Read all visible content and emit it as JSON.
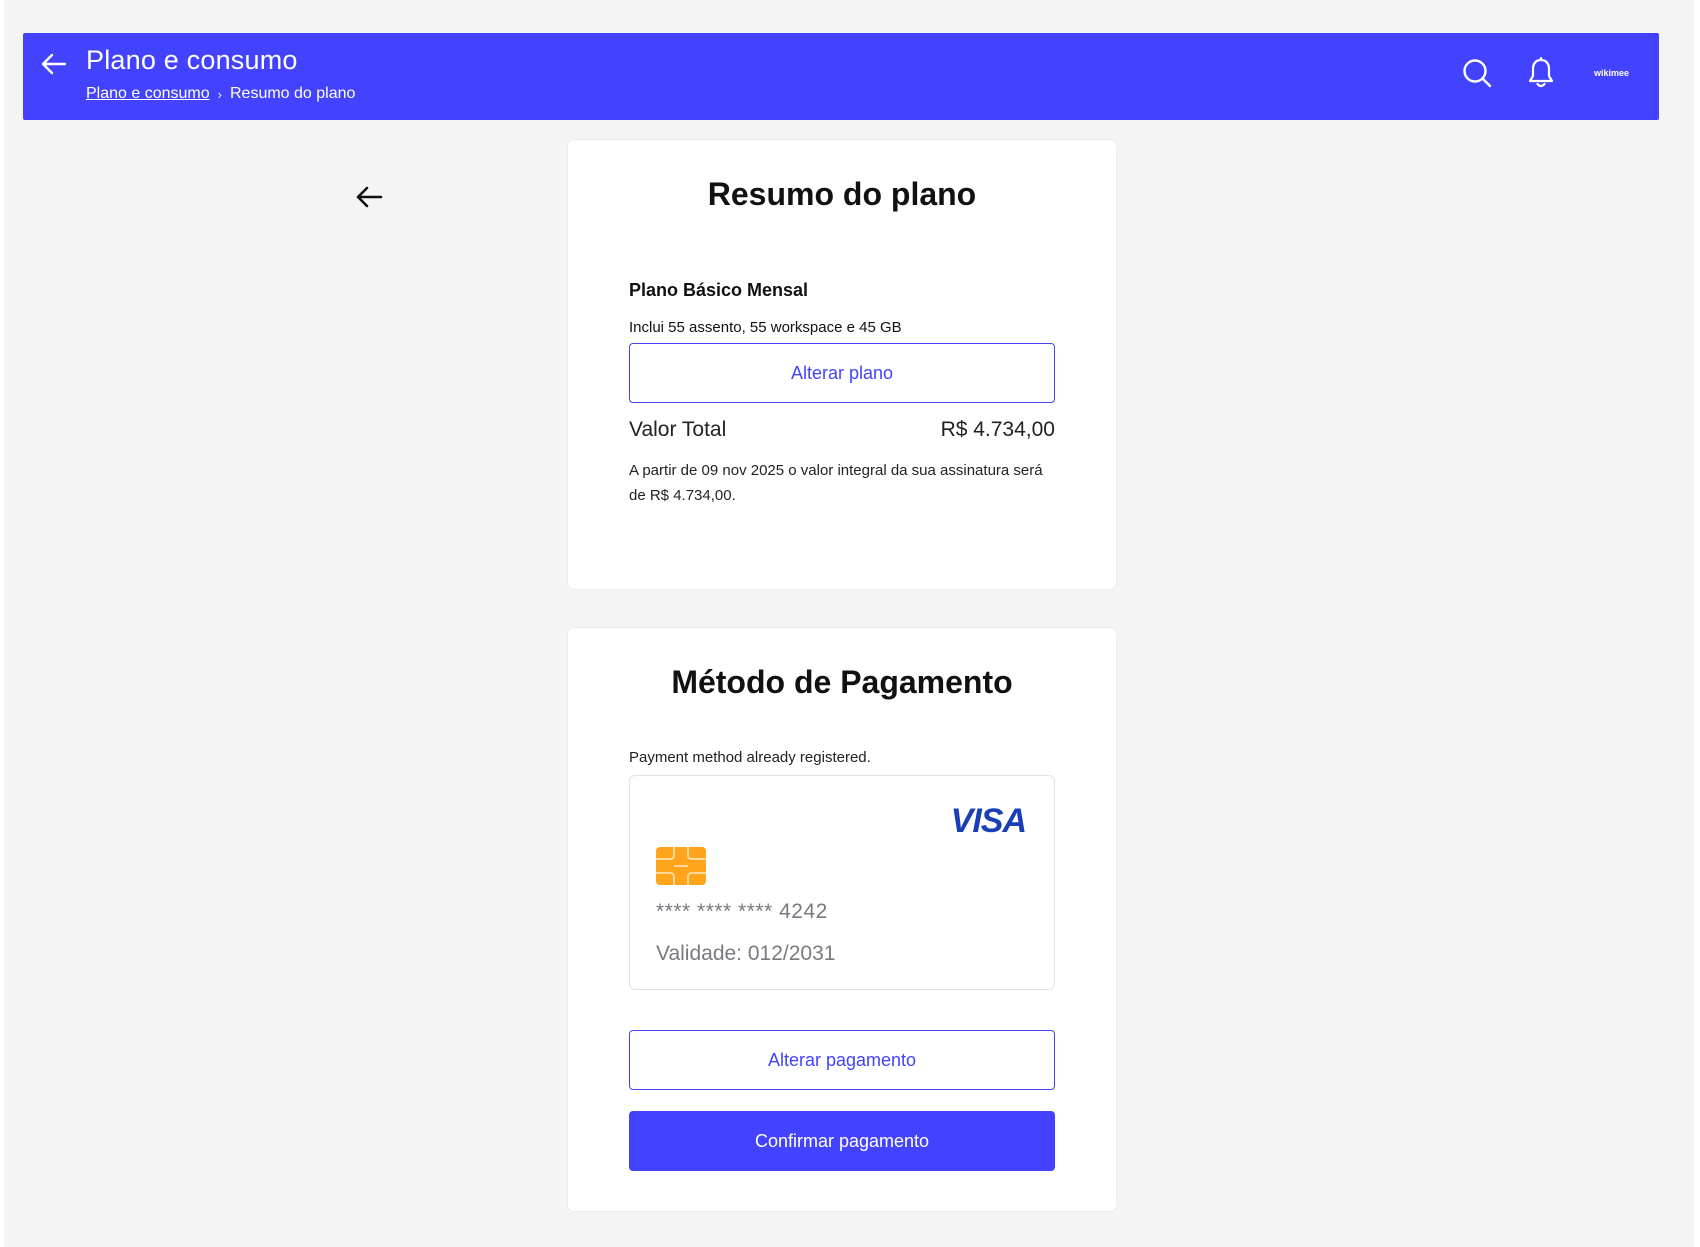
{
  "header": {
    "title": "Plano e consumo",
    "breadcrumb": {
      "parent": "Plano e consumo",
      "separator": "›",
      "current": "Resumo do plano"
    },
    "avatar_label": "wikimee",
    "accent_color": "#4343ff"
  },
  "icons": {
    "header_back": "arrow-left-icon",
    "search": "search-icon",
    "notifications": "bell-icon",
    "page_back": "arrow-left-icon",
    "card_chip": "chip-icon"
  },
  "plan_card": {
    "title": "Resumo do plano",
    "plan_name": "Plano Básico Mensal",
    "plan_description": "Inclui 55 assento, 55 workspace e 45 GB",
    "change_plan_label": "Alterar plano",
    "total_label": "Valor Total",
    "total_value": "R$ 4.734,00",
    "total_note": "A partir de 09 nov 2025 o valor integral da sua assinatura será de R$ 4.734,00."
  },
  "payment_card": {
    "title": "Método de Pagamento",
    "note": "Payment method already registered.",
    "card": {
      "brand": "VISA",
      "masked_prefix": "**** **** ****",
      "last_digits": "4242",
      "validity": "Validade: 012/2031"
    },
    "change_payment_label": "Alterar pagamento",
    "confirm_label": "Confirmar pagamento"
  }
}
